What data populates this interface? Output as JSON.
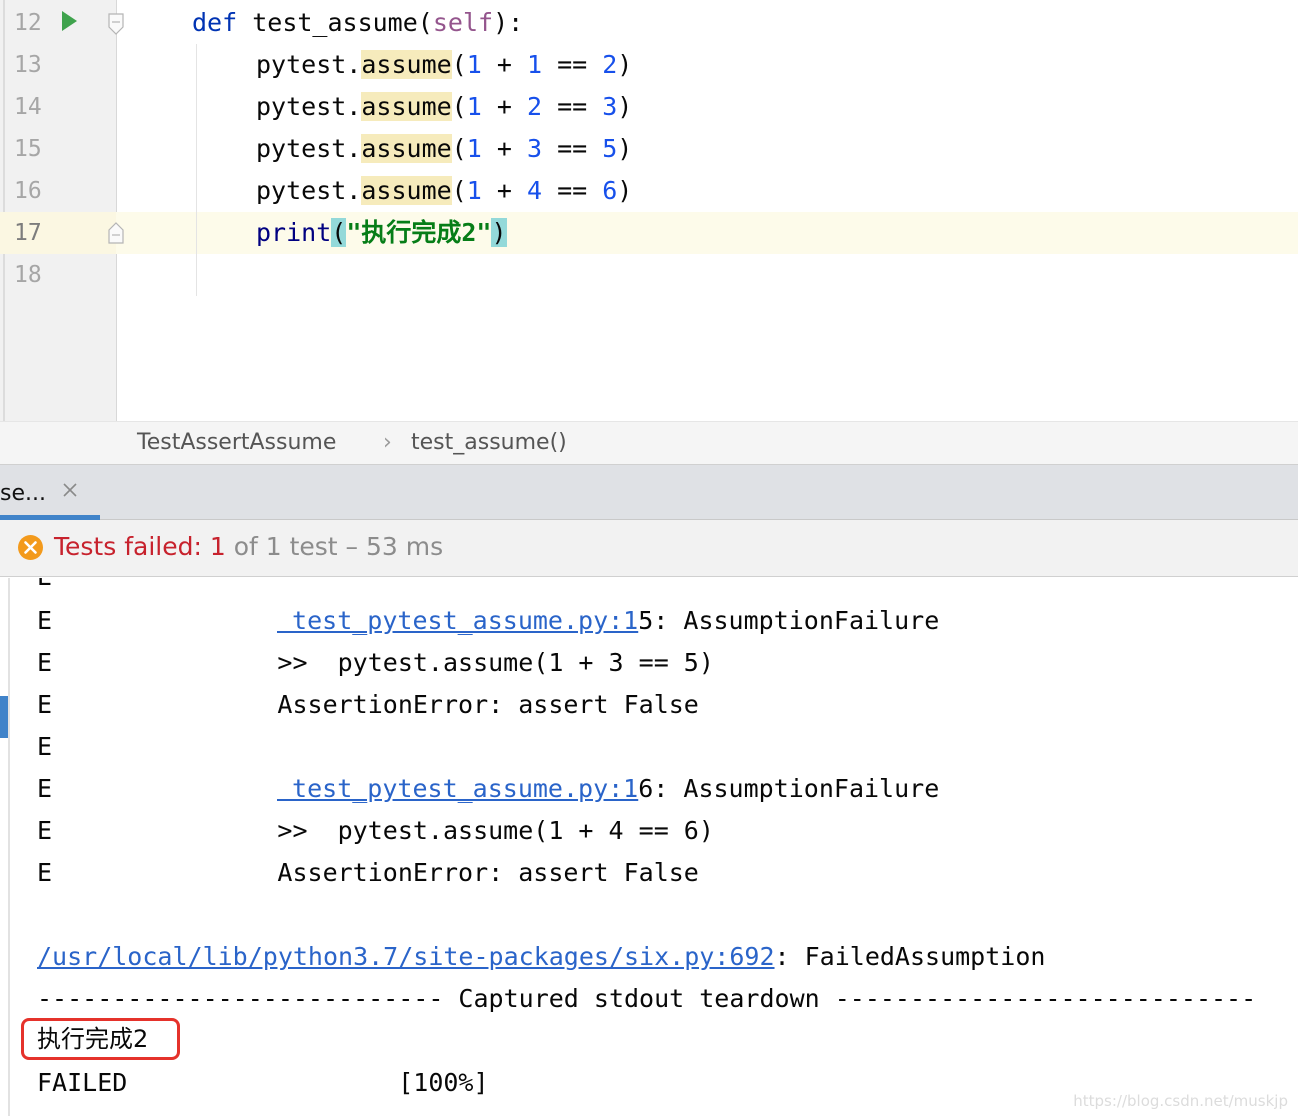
{
  "editor": {
    "lines": [
      {
        "num": "12",
        "text": "    def test_assume(self):"
      },
      {
        "num": "13",
        "text": "        pytest.assume(1 + 1 == 2)"
      },
      {
        "num": "14",
        "text": "        pytest.assume(1 + 2 == 3)"
      },
      {
        "num": "15",
        "text": "        pytest.assume(1 + 3 == 5)"
      },
      {
        "num": "16",
        "text": "        pytest.assume(1 + 4 == 6)"
      },
      {
        "num": "17",
        "text": "        print(\"执行完成2\")"
      },
      {
        "num": "18",
        "text": ""
      }
    ],
    "tokens": {
      "def": "def",
      "fn_name": "test_assume",
      "paren_open": "(",
      "self": "self",
      "paren_close_colon": "):",
      "pytest": "pytest.",
      "assume": "assume",
      "print": "print",
      "print_str": "\"执行完成2\""
    },
    "assume_args": [
      [
        "1",
        "1",
        "2"
      ],
      [
        "1",
        "2",
        "3"
      ],
      [
        "1",
        "3",
        "5"
      ],
      [
        "1",
        "4",
        "6"
      ]
    ]
  },
  "breadcrumb": {
    "class_name": "TestAssertAssume",
    "separator": "›",
    "method_name": "test_assume()"
  },
  "run_panel": {
    "tab_label": "se...",
    "status": {
      "prefix": "Tests failed: ",
      "failed": "1",
      "suffix": " of 1 test – 53 ms"
    },
    "icons": {
      "run": "run-triangle-icon",
      "fail": "fail-circle-icon",
      "close": "close-icon"
    }
  },
  "console": {
    "lines": [
      {
        "marker": "E",
        "text": ""
      },
      {
        "marker": "E",
        "link": " test_pytest_assume.py:1",
        "text": "5: AssumptionFailure"
      },
      {
        "marker": "E",
        "text": "        >>  pytest.assume(1 + 3 == 5)"
      },
      {
        "marker": "E",
        "text": "        AssertionError: assert False"
      },
      {
        "marker": "E",
        "text": ""
      },
      {
        "marker": "E",
        "link": " test_pytest_assume.py:1",
        "text": "6: AssumptionFailure"
      },
      {
        "marker": "E",
        "text": "        >>  pytest.assume(1 + 4 == 6)"
      },
      {
        "marker": "E",
        "text": "        AssertionError: assert False"
      }
    ],
    "six_link": "/usr/local/lib/python3.7/site-packages/six.py:692",
    "six_suffix": ": FailedAssumption",
    "captured_header": "--------------------------- Captured stdout teardown ----------------------------",
    "captured_output": "执行完成2",
    "result_line": "FAILED                  [100%]",
    "watermark": "https://blog.csdn.net/muskjp"
  },
  "colors": {
    "keyword": "#0033b3",
    "number": "#1750eb",
    "string": "#067d17",
    "fail_red": "#c7222d",
    "fail_icon": "#f39a1c",
    "link": "#2a64c9",
    "highlight_box": "#e5322b"
  }
}
